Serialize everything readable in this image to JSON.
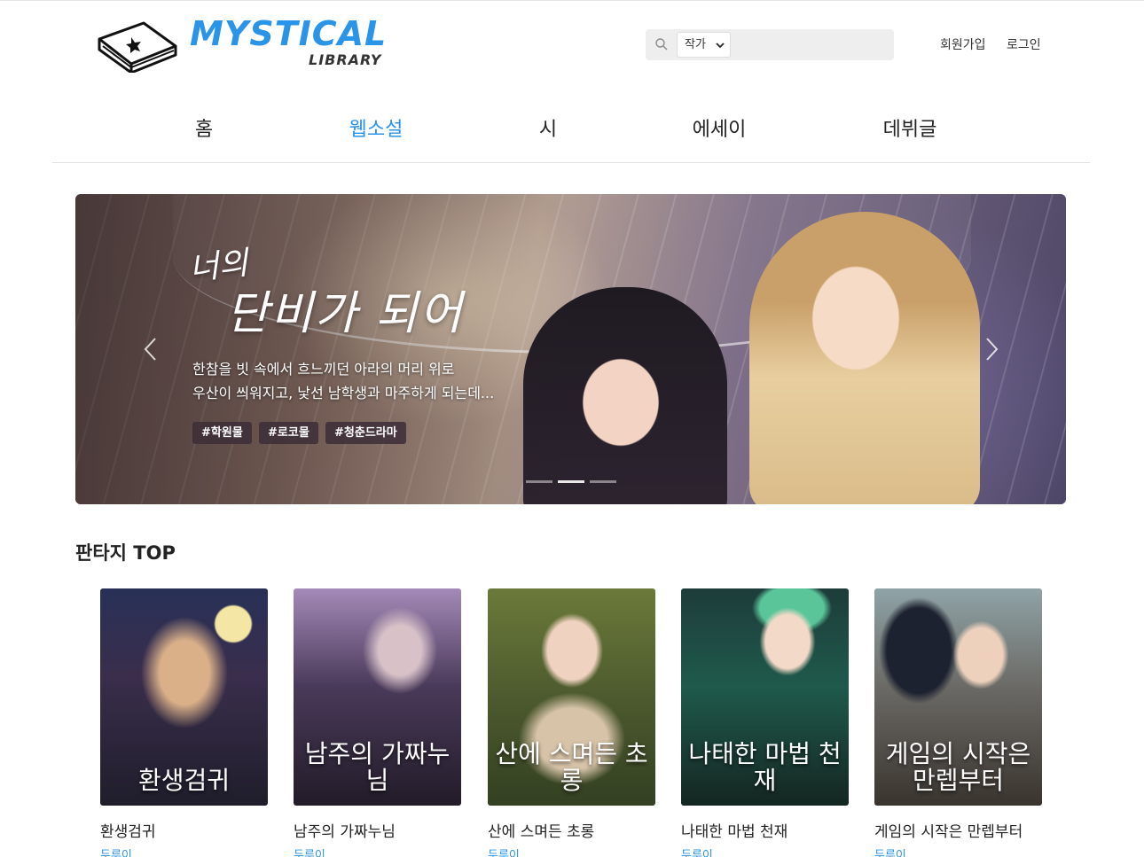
{
  "brand": {
    "title": "MYSTICAL",
    "subtitle": "LIBRARY",
    "accent": "#2a94e8"
  },
  "search": {
    "filter_selected": "작가",
    "placeholder": ""
  },
  "auth": {
    "signup": "회원가입",
    "login": "로그인"
  },
  "nav": [
    {
      "label": "홈",
      "active": false
    },
    {
      "label": "웹소설",
      "active": true
    },
    {
      "label": "시",
      "active": false
    },
    {
      "label": "에세이",
      "active": false
    },
    {
      "label": "데뷔글",
      "active": false
    }
  ],
  "banner": {
    "headline_line1": "너의",
    "headline_line2": "단비가 되어",
    "description_line1": "한참을 빗 속에서 흐느끼던 아라의 머리 위로",
    "description_line2": "우산이 씌워지고, 낯선 남학생과 마주하게 되는데...",
    "tags": [
      "#학원물",
      "#로코물",
      "#청춘드라마"
    ],
    "slide_count": 3,
    "active_slide": 1
  },
  "section": {
    "title": "판타지 TOP",
    "books": [
      {
        "title": "환생검귀",
        "author": "두루이",
        "cover_text": "환생검귀"
      },
      {
        "title": "남주의 가짜누님",
        "author": "두루이",
        "cover_text": "남주의 가짜누님"
      },
      {
        "title": "산에 스며든 초롱",
        "author": "두루이",
        "cover_text": "산에 스며든 초롱"
      },
      {
        "title": "나태한 마법 천재",
        "author": "두루이",
        "cover_text": "나태한 마법 천재"
      },
      {
        "title": "게임의 시작은 만렙부터",
        "author": "두루이",
        "cover_text": "게임의 시작은 만렙부터"
      }
    ]
  }
}
